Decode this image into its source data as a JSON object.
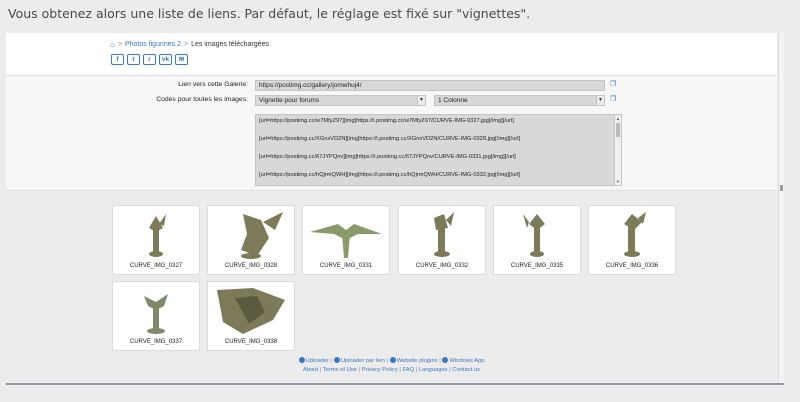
{
  "caption": "Vous obtenez alors une liste de liens. Par défaut, le réglage est fixé sur \"vignettes\".",
  "breadcrumb": {
    "home_icon": "home-icon",
    "parent": "Photos figurines 2",
    "current": "Les images téléchargées"
  },
  "share": [
    "f",
    "t",
    "r",
    "vk",
    "✉"
  ],
  "gallery": {
    "label": "Lien vers cette Galerie:",
    "value": "https://postimg.cc/gallery/jomwhuj4/"
  },
  "codes": {
    "label": "Codes pour toutes les images:",
    "format_selected": "Vignette pour forums",
    "columns_selected": "1 Colonne",
    "lines": [
      "[url=https://postimg.cc/w7MfyZ97][img]https://i.postimg.cc/w7MfyZ97/CURVE-IMG-0327.jpg[/img][/url]",
      "[url=https://postimg.cc/XGnxVD2N][img]https://i.postimg.cc/XGnxVD2N/CURVE-IMG-0328.jpg[/img][/url]",
      "[url=https://postimg.cc/67JYPQnv][img]https://i.postimg.cc/67JYPQnv/CURVE-IMG-0331.jpg[/img][/url]",
      "[url=https://postimg.cc/hQjrmQWH][img]https://i.postimg.cc/hQjrmQWH/CURVE-IMG-0332.jpg[/img][/url]"
    ]
  },
  "images": [
    {
      "name": "CURVE_IMG_0327"
    },
    {
      "name": "CURVE_IMG_0328"
    },
    {
      "name": "CURVE_IMG_0331"
    },
    {
      "name": "CURVE_IMG_0332"
    },
    {
      "name": "CURVE_IMG_0335"
    },
    {
      "name": "CURVE_IMG_0336"
    },
    {
      "name": "CURVE_IMG_0337"
    },
    {
      "name": "CURVE_IMG_0338"
    }
  ],
  "footer": {
    "row1": [
      "Uploader",
      "Uploader par lien",
      "Website plugins",
      "Windows App"
    ],
    "row2": [
      "About",
      "Terms of Use",
      "Privacy Policy",
      "FAQ",
      "Languages",
      "Contact us"
    ]
  },
  "colors": {
    "link": "#3a78c3",
    "field": "#d8d8d8",
    "figurine": "#7d7a5a"
  }
}
